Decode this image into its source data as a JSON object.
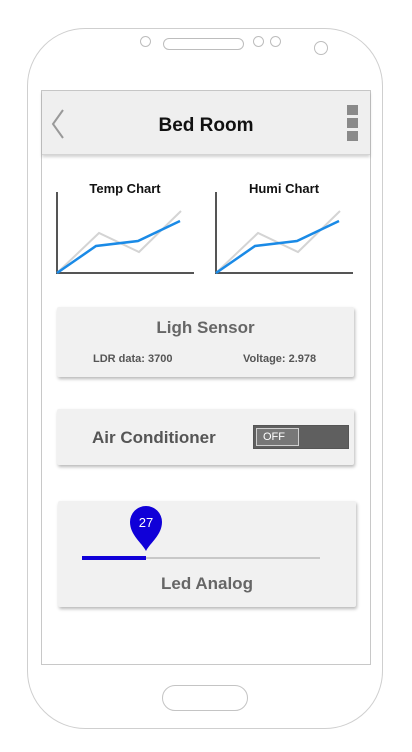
{
  "header": {
    "title": "Bed Room"
  },
  "charts": [
    {
      "title": "Temp Chart"
    },
    {
      "title": "Humi Chart"
    }
  ],
  "light_sensor": {
    "title": "Ligh Sensor",
    "ldr_text": "LDR data: 3700",
    "voltage_text": "Voltage: 2.978"
  },
  "air_conditioner": {
    "label": "Air Conditioner",
    "toggle_state": "OFF"
  },
  "led": {
    "label": "Led Analog",
    "value": "27",
    "level_fraction": 0.27
  },
  "colors": {
    "accent_blue": "#1a8ae6",
    "slider_blue": "#1000d8"
  }
}
